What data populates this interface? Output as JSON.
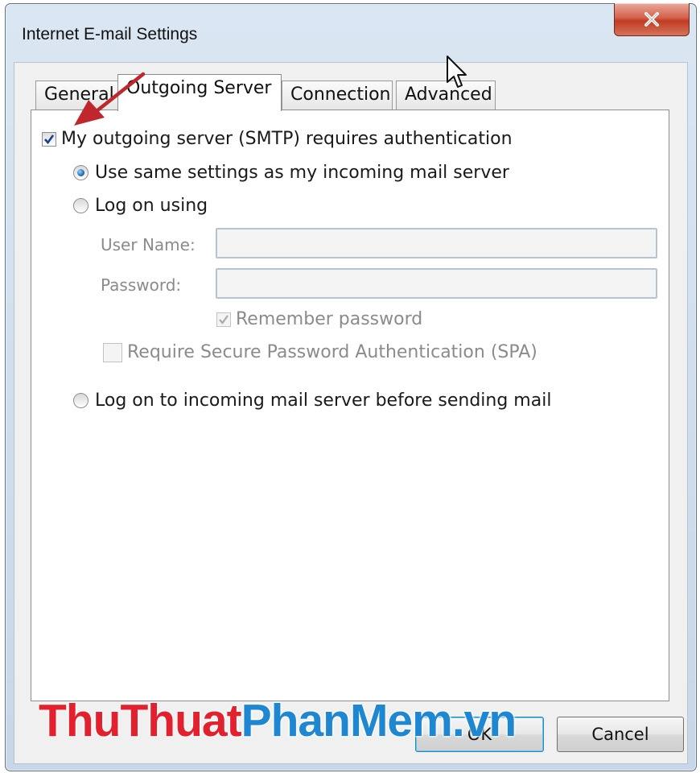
{
  "window": {
    "title": "Internet E-mail Settings",
    "close_label": "X"
  },
  "tabs": [
    {
      "label": "General",
      "active": false
    },
    {
      "label": "Outgoing Server",
      "active": true
    },
    {
      "label": "Connection",
      "active": false
    },
    {
      "label": "Advanced",
      "active": false
    }
  ],
  "outgoing": {
    "requires_auth": {
      "label": "My outgoing server (SMTP) requires authentication",
      "checked": true
    },
    "same_settings": {
      "label": "Use same settings as my incoming mail server",
      "selected": true
    },
    "log_on_using": {
      "label": "Log on using",
      "selected": false
    },
    "user_name": {
      "label": "User Name:",
      "value": ""
    },
    "password": {
      "label": "Password:",
      "value": ""
    },
    "remember_password": {
      "label": "Remember password",
      "checked": true,
      "enabled": false
    },
    "require_spa": {
      "label": "Require Secure Password Authentication (SPA)",
      "checked": false,
      "enabled": false
    },
    "log_on_incoming": {
      "label": "Log on to incoming mail server before sending mail",
      "selected": false
    }
  },
  "buttons": {
    "ok_label": "OK",
    "cancel_label": "Cancel"
  },
  "watermark": {
    "part1": "ThuThuat",
    "part2": "PhanMem",
    "part3": ".vn"
  },
  "colors": {
    "arrow": "#c0272d",
    "close_button": "#c8482f",
    "watermark_red": "#e2202e",
    "watermark_blue": "#1f86d2"
  }
}
